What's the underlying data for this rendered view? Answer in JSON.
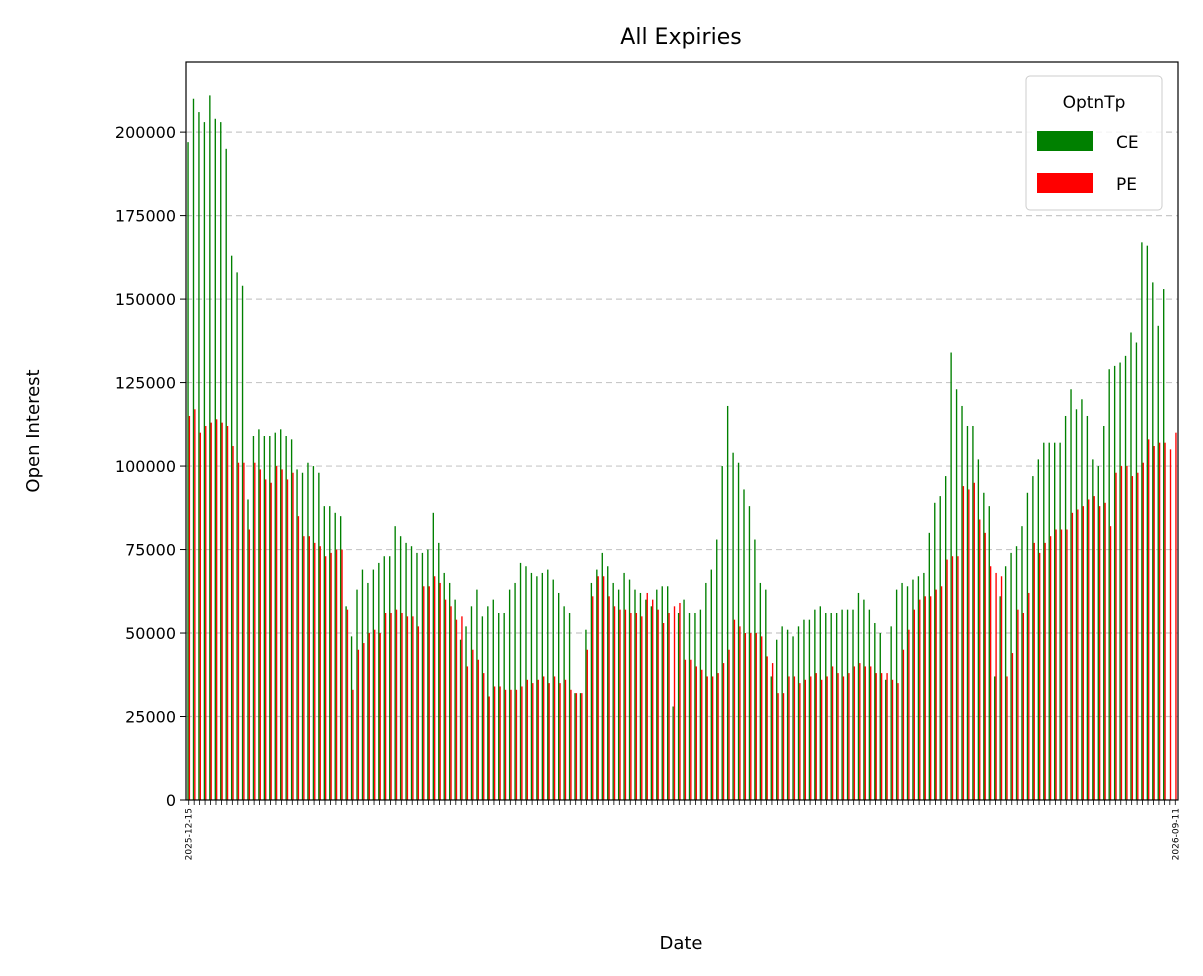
{
  "chart_data": {
    "type": "bar",
    "title": "All Expiries",
    "xlabel": "Date",
    "ylabel": "Open Interest",
    "ylim": [
      0,
      221000
    ],
    "yticks": [
      0,
      25000,
      50000,
      75000,
      100000,
      125000,
      150000,
      175000,
      200000
    ],
    "ytick_labels": [
      "0",
      "25000",
      "50000",
      "75000",
      "100000",
      "125000",
      "150000",
      "175000",
      "200000"
    ],
    "grid": "y dashed",
    "legend": {
      "title": "OptnTp",
      "position": "top-right"
    },
    "x_first_label": "2025-12-15",
    "x_last_label": "2026-09-11",
    "series": [
      {
        "name": "CE",
        "color": "#008000",
        "values": [
          197000,
          210000,
          206000,
          203000,
          211000,
          204000,
          203000,
          195000,
          163000,
          158000,
          154000,
          90000,
          109000,
          111000,
          109000,
          109000,
          110000,
          111000,
          109000,
          108000,
          99000,
          98000,
          101000,
          100000,
          98000,
          88000,
          88000,
          86000,
          85000,
          58000,
          49000,
          63000,
          69000,
          65000,
          69000,
          71000,
          73000,
          73000,
          82000,
          79000,
          77000,
          76000,
          74000,
          74000,
          75000,
          86000,
          77000,
          68000,
          65000,
          60000,
          48000,
          52000,
          58000,
          63000,
          55000,
          58000,
          60000,
          56000,
          56000,
          63000,
          65000,
          71000,
          70000,
          68000,
          67000,
          68000,
          69000,
          66000,
          62000,
          58000,
          56000,
          32000,
          32000,
          51000,
          65000,
          69000,
          74000,
          70000,
          65000,
          63000,
          68000,
          66000,
          63000,
          62000,
          60000,
          58000,
          63000,
          64000,
          64000,
          28000,
          56000,
          60000,
          56000,
          56000,
          57000,
          65000,
          69000,
          78000,
          100000,
          118000,
          104000,
          101000,
          93000,
          88000,
          78000,
          65000,
          63000,
          37000,
          48000,
          52000,
          51000,
          49000,
          52000,
          54000,
          54000,
          57000,
          58000,
          56000,
          56000,
          56000,
          57000,
          57000,
          57000,
          62000,
          60000,
          57000,
          53000,
          50000,
          36000,
          52000,
          63000,
          65000,
          64000,
          66000,
          67000,
          68000,
          80000,
          89000,
          91000,
          97000,
          134000,
          123000,
          118000,
          112000,
          112000,
          102000,
          92000,
          88000,
          37000,
          61000,
          70000,
          74000,
          76000,
          82000,
          92000,
          97000,
          102000,
          107000,
          107000,
          107000,
          107000,
          115000,
          123000,
          117000,
          120000,
          115000,
          102000,
          100000,
          112000,
          129000,
          130000,
          131000,
          133000,
          140000,
          137000,
          167000,
          166000,
          155000,
          142000,
          153000
        ],
        "pe_values_note": ""
      },
      {
        "name": "PE",
        "color": "#ff0000",
        "values": [
          115000,
          117000,
          110000,
          112000,
          113000,
          114000,
          113000,
          112000,
          106000,
          101000,
          101000,
          81000,
          101000,
          99000,
          96000,
          95000,
          100000,
          99000,
          96000,
          98000,
          85000,
          79000,
          79000,
          77000,
          76000,
          73000,
          74000,
          75000,
          75000,
          57000,
          33000,
          45000,
          47000,
          50000,
          51000,
          50000,
          56000,
          56000,
          57000,
          56000,
          55000,
          55000,
          52000,
          64000,
          64000,
          67000,
          65000,
          60000,
          58000,
          54000,
          55000,
          40000,
          45000,
          42000,
          38000,
          31000,
          34000,
          34000,
          33000,
          33000,
          33000,
          34000,
          36000,
          35000,
          36000,
          37000,
          35000,
          37000,
          35000,
          36000,
          33000,
          32000,
          32000,
          45000,
          61000,
          67000,
          67000,
          61000,
          58000,
          57000,
          57000,
          56000,
          56000,
          55000,
          62000,
          60000,
          57000,
          53000,
          56000,
          58000,
          59000,
          42000,
          42000,
          40000,
          39000,
          37000,
          37000,
          38000,
          41000,
          45000,
          54000,
          52000,
          50000,
          50000,
          50000,
          49000,
          43000,
          41000,
          32000,
          32000,
          37000,
          37000,
          35000,
          36000,
          37000,
          38000,
          36000,
          37000,
          40000,
          38000,
          37000,
          38000,
          40000,
          41000,
          40000,
          40000,
          38000,
          38000,
          38000,
          36000,
          35000,
          45000,
          51000,
          57000,
          60000,
          61000,
          61000,
          63000,
          64000,
          72000,
          73000,
          73000,
          94000,
          93000,
          95000,
          84000,
          80000,
          70000,
          68000,
          67000,
          37000,
          44000,
          57000,
          56000,
          62000,
          77000,
          74000,
          77000,
          79000,
          81000,
          81000,
          81000,
          86000,
          87000,
          88000,
          90000,
          91000,
          88000,
          89000,
          82000,
          98000,
          100000,
          100000,
          97000,
          98000,
          101000,
          108000,
          106000,
          107000,
          107000,
          105000,
          110000
        ]
      }
    ]
  }
}
